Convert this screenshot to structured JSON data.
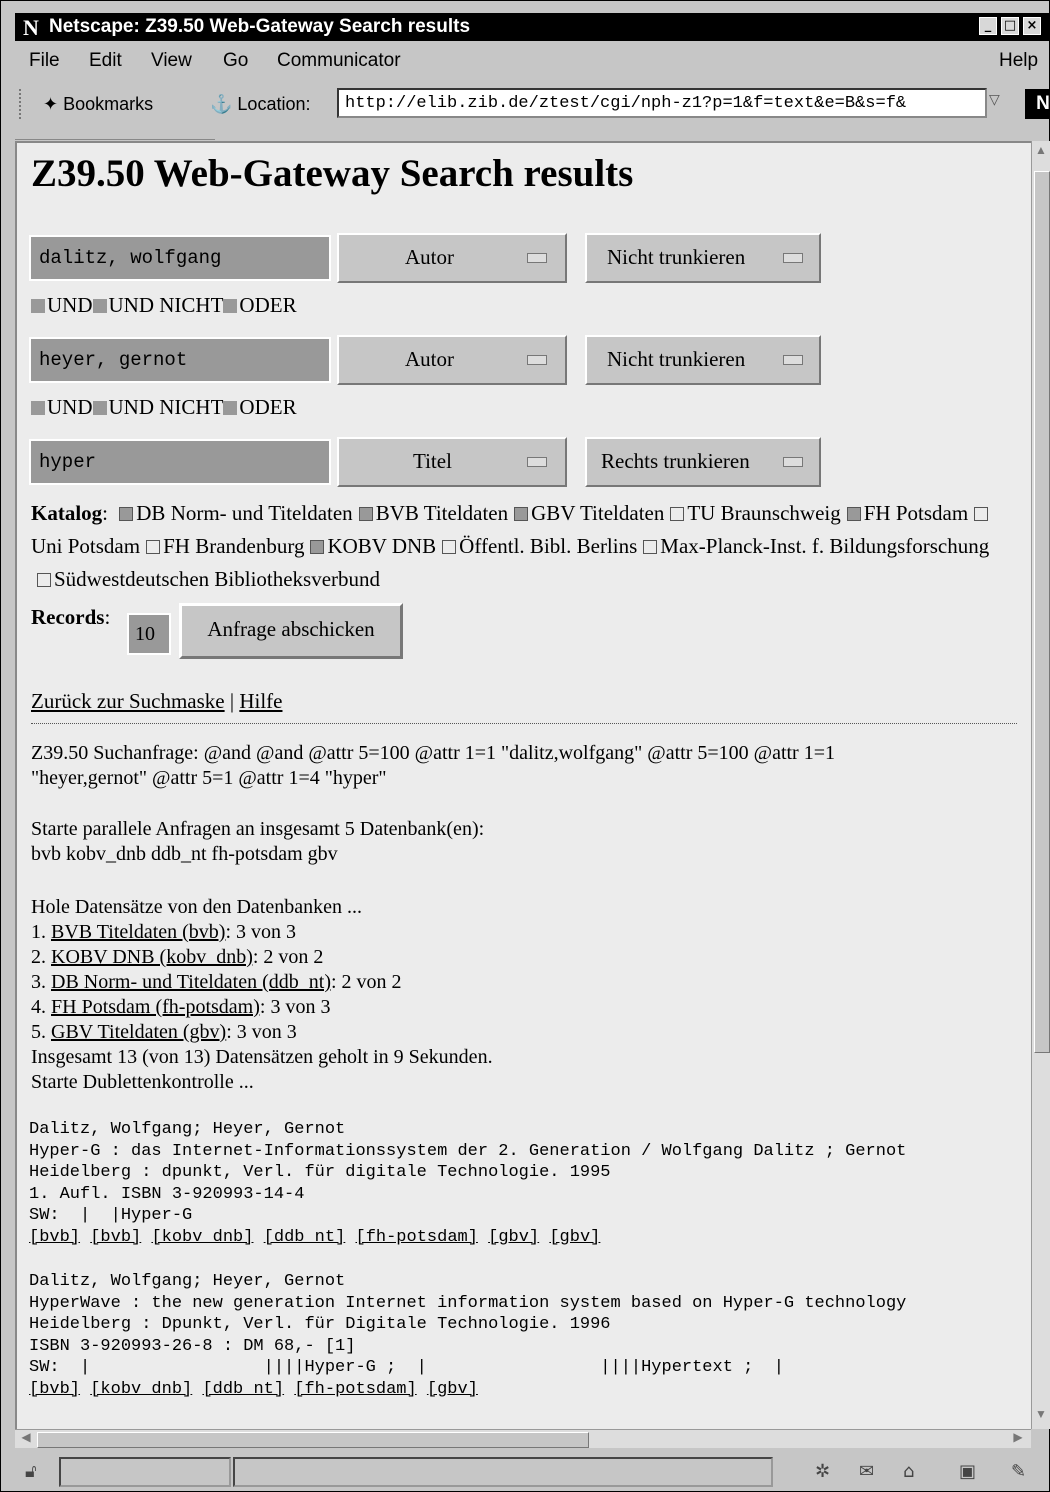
{
  "window": {
    "logo": "N",
    "title": "Netscape: Z39.50 Web-Gateway Search results"
  },
  "menu": [
    "File",
    "Edit",
    "View",
    "Go",
    "Communicator",
    "Help"
  ],
  "toolbar": {
    "bookmarks_label": "Bookmarks",
    "location_label": "Location:",
    "url": "http://elib.zib.de/ztest/cgi/nph-z1?p=1&f=text&e=B&s=f&",
    "netscape_logo": "N"
  },
  "page": {
    "title": "Z39.50 Web-Gateway Search results",
    "rows": [
      {
        "term": "dalitz, wolfgang",
        "field": "Autor",
        "trunc": "Nicht trunkieren"
      },
      {
        "term": "heyer, gernot",
        "field": "Autor",
        "trunc": "Nicht trunkieren"
      },
      {
        "term": "hyper",
        "field": "Titel",
        "trunc": "Rechts trunkieren"
      }
    ],
    "connectors": [
      "UND",
      "UND NICHT",
      "ODER"
    ],
    "katalog_label": "Katalog",
    "catalogs": [
      {
        "name": "DB Norm- und Titeldaten",
        "checked": true
      },
      {
        "name": "BVB Titeldaten",
        "checked": true
      },
      {
        "name": "GBV Titeldaten",
        "checked": true
      },
      {
        "name": "TU Braunschweig",
        "checked": false
      },
      {
        "name": "FH Potsdam",
        "checked": true
      },
      {
        "name": "Uni Potsdam",
        "checked": false
      },
      {
        "name": "FH Brandenburg",
        "checked": false
      },
      {
        "name": "KOBV DNB",
        "checked": true
      },
      {
        "name": "Öffentl. Bibl. Berlins",
        "checked": false
      },
      {
        "name": "Max-Planck-Inst. f. Bildungsforschung",
        "checked": false
      },
      {
        "name": "Südwestdeutschen Bibliotheksverbund",
        "checked": false
      }
    ],
    "records_label": "Records",
    "records_value": "10",
    "submit_label": "Anfrage abschicken",
    "link_back": "Zurück zur Suchmaske",
    "link_sep": "|",
    "link_help": "Hilfe",
    "query_line1": "Z39.50 Suchanfrage: @and @and @attr 5=100 @attr 1=1 \"dalitz,wolfgang\" @attr 5=100 @attr 1=1",
    "query_line2": "\"heyer,gernot\" @attr 5=1 @attr 1=4 \"hyper\"",
    "parallel_line1": "Starte parallele Anfragen an insgesamt 5 Datenbank(en):",
    "parallel_line2": "bvb kobv_dnb ddb_nt fh-potsdam gbv",
    "fetch_line": "Hole Datensätze von den Datenbanken ...",
    "db_results": [
      {
        "num": "1.",
        "link": "BVB Titeldaten (bvb)",
        "count": ": 3 von 3"
      },
      {
        "num": "2.",
        "link": "KOBV DNB (kobv_dnb)",
        "count": ": 2 von 2"
      },
      {
        "num": "3.",
        "link": "DB Norm- und Titeldaten (ddb_nt)",
        "count": ": 2 von 2"
      },
      {
        "num": "4.",
        "link": "FH Potsdam (fh-potsdam)",
        "count": ": 3 von 3"
      },
      {
        "num": "5.",
        "link": "GBV Titeldaten (gbv)",
        "count": ": 3 von 3"
      }
    ],
    "total_line": "Insgesamt 13 (von 13) Datensätzen geholt in 9 Sekunden.",
    "dedup_line": "Starte Dublettenkontrolle ...",
    "record1": {
      "lines": [
        "Dalitz, Wolfgang; Heyer, Gernot",
        "Hyper-G : das Internet-Informationssystem der 2. Generation / Wolfgang Dalitz ; Gernot",
        "Heidelberg : dpunkt, Verl. für digitale Technologie. 1995",
        "1. Aufl. ISBN 3-920993-14-4",
        "SW:  |  |Hyper-G"
      ],
      "links": [
        "[bvb]",
        "[bvb]",
        "[kobv_dnb]",
        "[ddb_nt]",
        "[fh-potsdam]",
        "[gbv]",
        "[gbv]"
      ]
    },
    "record2": {
      "lines": [
        "Dalitz, Wolfgang; Heyer, Gernot",
        "HyperWave : the new generation Internet information system based on Hyper-G technology",
        "Heidelberg : Dpunkt, Verl. für Digitale Technologie. 1996",
        "ISBN 3-920993-26-8 : DM 68,- [1]",
        "SW:  |                 ||||Hyper-G ;  |                 ||||Hypertext ;  |"
      ],
      "links": [
        "[bvb]",
        "[kobv_dnb]",
        "[ddb_nt]",
        "[fh-potsdam]",
        "[gbv]"
      ]
    }
  }
}
